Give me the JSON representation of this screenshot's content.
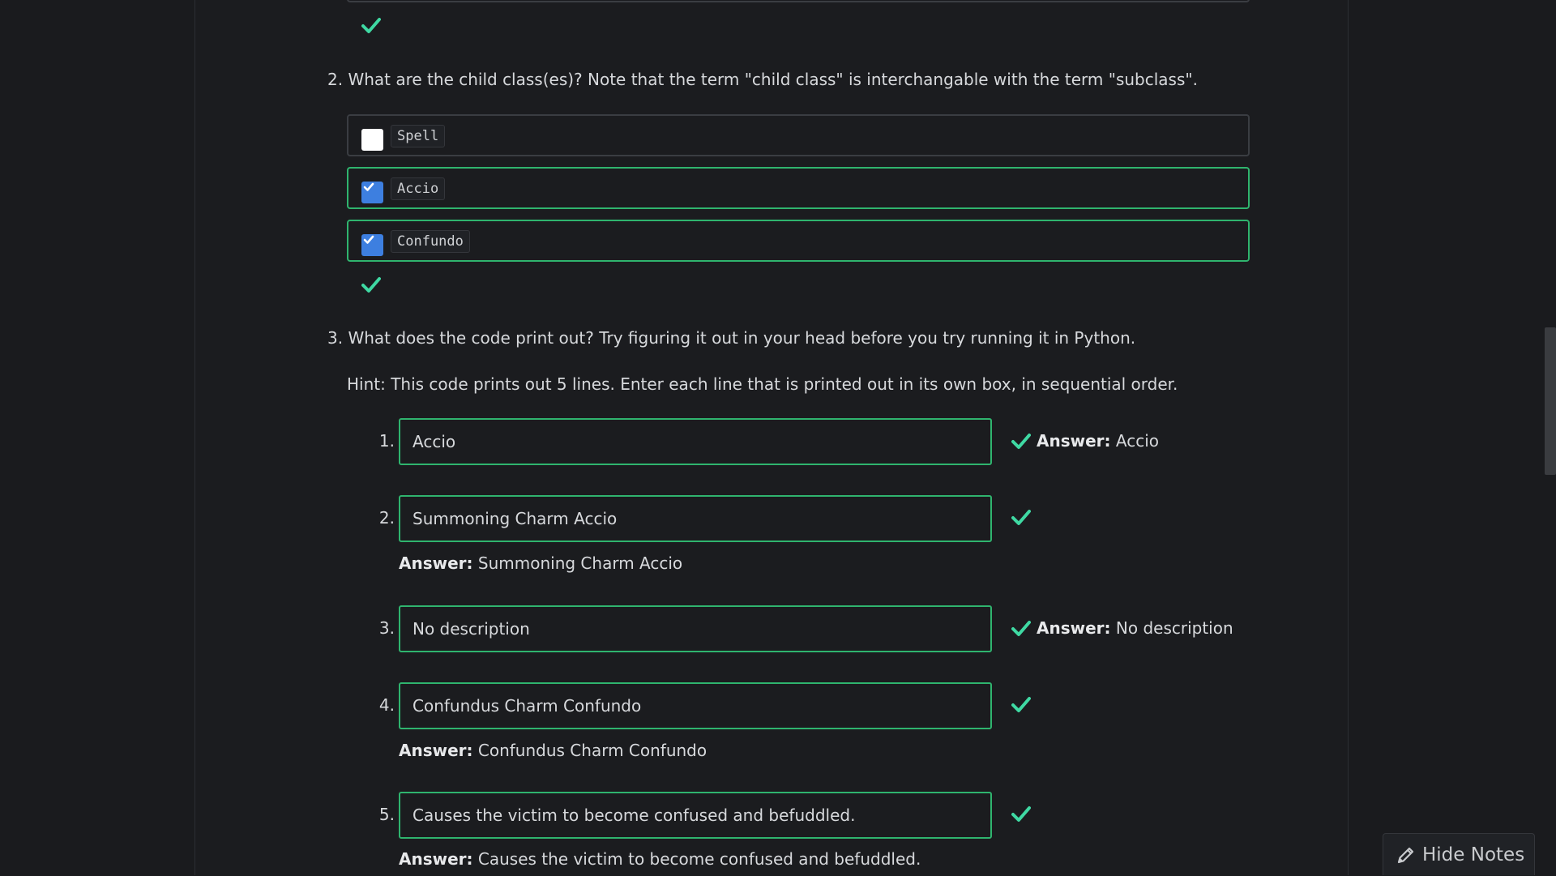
{
  "colors": {
    "success_green": "#2fb46e",
    "check_teal": "#3fd9a3",
    "checkbox_blue": "#3d7fe0",
    "background": "#1b1c1f"
  },
  "q2": {
    "prompt": "2. What are the child class(es)? Note that the term \"child class\" is interchangable with the term \"subclass\".",
    "choices": [
      {
        "label": "Spell",
        "checked": false
      },
      {
        "label": "Accio",
        "checked": true
      },
      {
        "label": "Confundo",
        "checked": true
      }
    ]
  },
  "q3": {
    "prompt": "3. What does the code print out? Try figuring it out in your head before you try running it in Python.",
    "hint": "Hint: This code prints out 5 lines. Enter each line that is printed out in its own box, in sequential order.",
    "answer_label": "Answer:",
    "lines": [
      {
        "num": "1.",
        "value": "Accio",
        "answer": "Accio"
      },
      {
        "num": "2.",
        "value": "Summoning Charm Accio",
        "answer": "Summoning Charm Accio"
      },
      {
        "num": "3.",
        "value": "No description",
        "answer": "No description"
      },
      {
        "num": "4.",
        "value": "Confundus Charm Confundo",
        "answer": "Confundus Charm Confundo"
      },
      {
        "num": "5.",
        "value": "Causes the victim to become confused and befuddled.",
        "answer": "Causes the victim to become confused and befuddled."
      }
    ]
  },
  "notes_button": {
    "label": "Hide Notes",
    "icon": "pencil-icon"
  }
}
